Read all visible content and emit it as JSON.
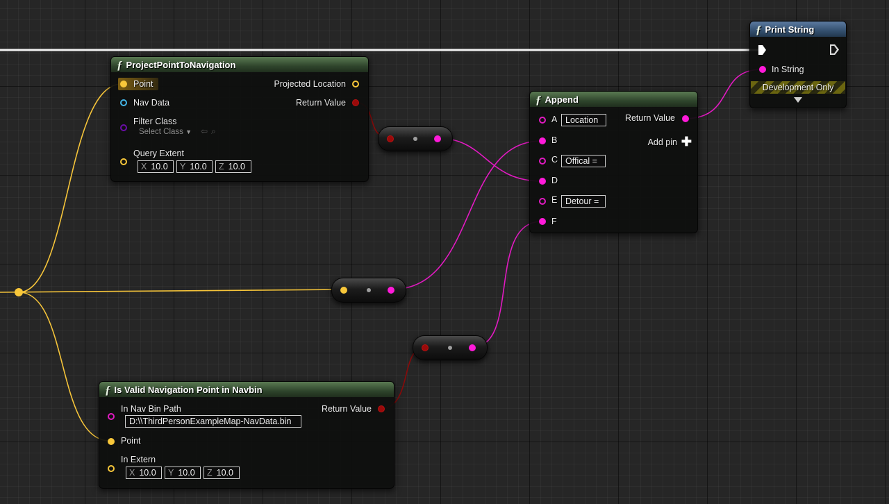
{
  "colors": {
    "exec": "#ffffff",
    "vector_pin": "#f8c73a",
    "string_pin": "#ff1ad9",
    "bool_pin": "#9a0a0a",
    "object_pin": "#43b6e8",
    "class_pin": "#6b0da8",
    "function_header": "#2f452c",
    "print_header": "#34506f"
  },
  "project_node": {
    "title": "ProjectPointToNavigation",
    "icon": "function-icon",
    "pins": {
      "point": "Point",
      "nav_data": "Nav Data",
      "filter_class": "Filter Class",
      "select_class": "Select Class",
      "query_extent": "Query Extent",
      "projected_location": "Projected Location",
      "return_value": "Return Value"
    },
    "extent": {
      "x_label": "X",
      "x": "10.0",
      "y_label": "Y",
      "y": "10.0",
      "z_label": "Z",
      "z": "10.0"
    }
  },
  "append_node": {
    "title": "Append",
    "icon": "function-icon",
    "pins": {
      "a": "A",
      "a_value": "Location",
      "b": "B",
      "c": "C",
      "c_value": "Offical =",
      "d": "D",
      "e": "E",
      "e_value": "Detour =",
      "f": "F",
      "return_value": "Return Value",
      "add_pin": "Add pin"
    }
  },
  "print_node": {
    "title": "Print String",
    "icon": "function-icon",
    "in_string": "In String",
    "development_only": "Development Only"
  },
  "valid_node": {
    "title": "Is Valid Navigation Point in Navbin",
    "icon": "function-icon",
    "pins": {
      "in_nav_bin_path": "In Nav Bin Path",
      "path_value": "D:\\\\ThirdPersonExampleMap-NavData.bin",
      "return_value": "Return Value",
      "point": "Point",
      "in_extern": "In Extern"
    },
    "extent": {
      "x_label": "X",
      "x": "10.0",
      "y_label": "Y",
      "y": "10.0",
      "z_label": "Z",
      "z": "10.0"
    }
  }
}
